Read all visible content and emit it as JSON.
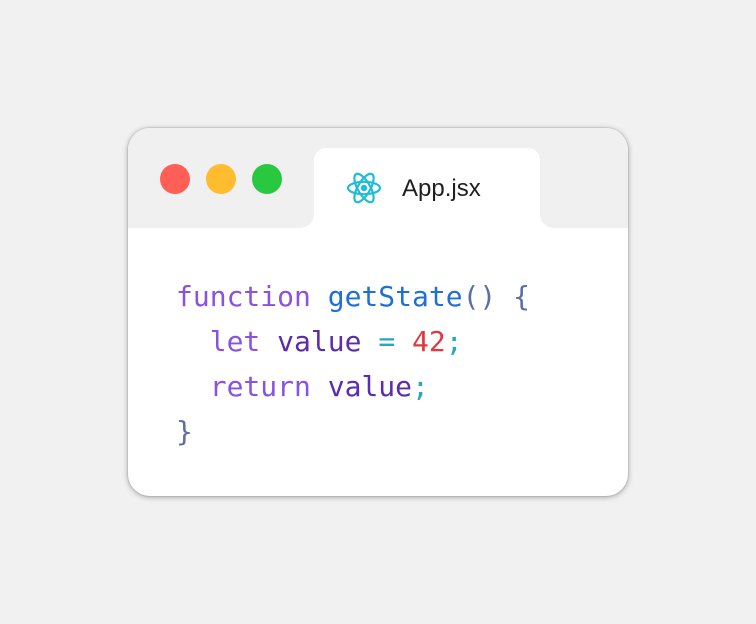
{
  "window": {
    "controls": {
      "close_color": "#ff5f57",
      "minimize_color": "#febc2e",
      "zoom_color": "#28c840"
    },
    "tab": {
      "icon": "react-icon",
      "icon_color": "#1fbcd6",
      "label": "App.jsx"
    }
  },
  "code": {
    "line1": {
      "keyword": "function",
      "function_name": "getState",
      "parens": "()",
      "brace_open": "{"
    },
    "line2": {
      "keyword": "let",
      "variable": "value",
      "operator": "=",
      "number": "42",
      "semicolon": ";"
    },
    "line3": {
      "keyword": "return",
      "variable": "value",
      "semicolon": ";"
    },
    "line4": {
      "brace_close": "}"
    }
  }
}
